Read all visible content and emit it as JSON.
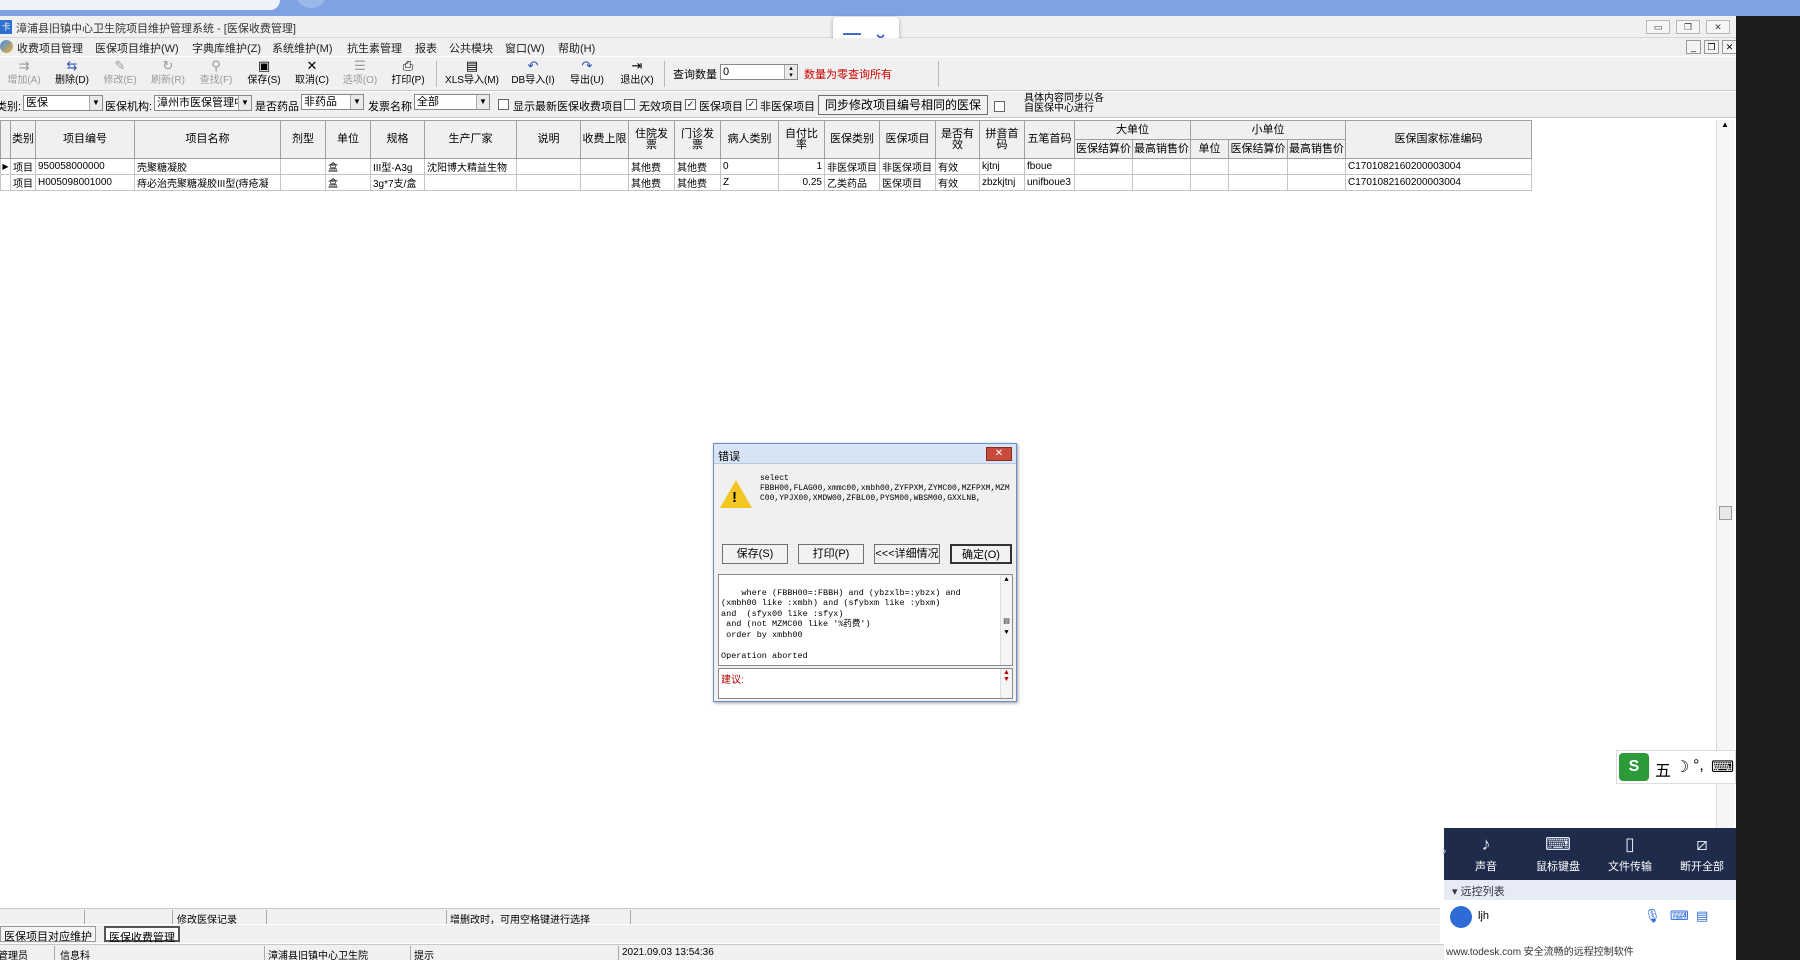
{
  "app": {
    "title": "漳浦县旧镇中心卫生院项目维护管理系统 - [医保收费管理]",
    "icon_char": "卡"
  },
  "menu": [
    "收费项目管理",
    "医保项目维护(W)",
    "字典库维护(Z)",
    "系统维护(M)",
    "抗生素管理",
    "报表",
    "公共模块",
    "窗口(W)",
    "帮助(H)"
  ],
  "toolbar": {
    "buttons": [
      {
        "label": "增加(A)",
        "icon": "add-icon",
        "enabled": false
      },
      {
        "label": "删除(D)",
        "icon": "delete-icon",
        "enabled": true
      },
      {
        "label": "修改(E)",
        "icon": "edit-icon",
        "enabled": false
      },
      {
        "label": "刷新(R)",
        "icon": "refresh-icon",
        "enabled": false
      },
      {
        "label": "查找(F)",
        "icon": "find-icon",
        "enabled": false
      },
      {
        "label": "保存(S)",
        "icon": "save-icon",
        "enabled": true
      },
      {
        "label": "取消(C)",
        "icon": "cancel-icon",
        "enabled": true
      },
      {
        "label": "选项(O)",
        "icon": "options-icon",
        "enabled": false
      },
      {
        "label": "打印(P)",
        "icon": "print-icon",
        "enabled": true
      },
      {
        "label": "XLS导入(M)",
        "icon": "xls-import-icon",
        "enabled": true
      },
      {
        "label": "DB导入(I)",
        "icon": "db-import-icon",
        "enabled": true
      },
      {
        "label": "导出(U)",
        "icon": "export-icon",
        "enabled": true
      },
      {
        "label": "退出(X)",
        "icon": "exit-icon",
        "enabled": true
      }
    ],
    "query_count_label": "查询数量",
    "query_count_value": "0",
    "query_hint": "数量为零查询所有",
    "hint_color": "#cc0000"
  },
  "filters": {
    "category_label": "类别:",
    "category_value": "医保",
    "org_label": "医保机构:",
    "org_value": "漳州市医保管理中",
    "is_drug_label": "是否药品",
    "is_drug_value": "非药品",
    "invoice_label": "发票名称",
    "invoice_value": "全部",
    "show_latest_label": "显示最新医保收费项目",
    "show_latest_checked": false,
    "invalid_label": "无效项目",
    "invalid_checked": false,
    "insured_label": "医保项目",
    "insured_checked": true,
    "non_insured_label": "非医保项目",
    "non_insured_checked": true,
    "sync_button": "同步修改项目编号相同的医保",
    "sync_checked": false,
    "sync_note_line1": "具体内容同步以各",
    "sync_note_line2": "自医保中心进行"
  },
  "grid": {
    "headers": [
      "类别",
      "项目编号",
      "项目名称",
      "剂型",
      "单位",
      "规格",
      "生产厂家",
      "说明",
      "收费上限",
      "住院发票",
      "门诊发票",
      "病人类别",
      "自付比率",
      "医保类别",
      "医保项目",
      "是否有效",
      "拼音首码",
      "五笔首码",
      "大单位",
      "小单位",
      "医保国家标准编码"
    ],
    "big_unit_sub": [
      "医保结算价",
      "最高销售价"
    ],
    "small_unit_sub": [
      "单位",
      "医保结算价",
      "最高销售价"
    ],
    "rows": [
      {
        "cat": "项目",
        "code": "950058000000",
        "name": "壳聚糖凝胶",
        "form": "",
        "unit": "盒",
        "spec": "III型-A3g",
        "maker": "沈阳博大精益生物",
        "note": "",
        "cap": "",
        "inpatient_invoice": "其他费",
        "outpatient_invoice": "其他费",
        "patient_type": "0",
        "self_pay": "1",
        "ins_type": "非医保项目",
        "ins_item": "非医保项目",
        "valid": "有效",
        "py": "kjtnj",
        "wb": "fboue",
        "big_price": "",
        "big_max": "",
        "small_unit": "",
        "small_price": "",
        "small_max": "",
        "national_code": "C1701082160200003004"
      },
      {
        "cat": "项目",
        "code": "H005098001000",
        "name": "痔必治壳聚糖凝胶III型(痔疮凝",
        "form": "",
        "unit": "盒",
        "spec": "3g*7支/盒",
        "maker": "",
        "note": "",
        "cap": "",
        "inpatient_invoice": "其他费",
        "outpatient_invoice": "其他费",
        "patient_type": "Z",
        "self_pay": "0.25",
        "ins_type": "乙类药品",
        "ins_item": "医保项目",
        "valid": "有效",
        "py": "zbzkjtnj",
        "wb": "unifboue3",
        "big_price": "",
        "big_max": "",
        "small_unit": "",
        "small_price": "",
        "small_max": "",
        "national_code": "C1701082160200003004"
      }
    ]
  },
  "dialog": {
    "title": "错误",
    "message": "select\nFBBH00,FLAG00,xmmc00,xmbh00,ZYFPXM,ZYMC00,MZFPXM,MZMC00,YPJX00,XMDW00,ZFBL00,PYSM00,WBSM00,GXXLNB,",
    "buttons": [
      "保存(S)",
      "打印(P)",
      "<<<详细情况",
      "确定(O)"
    ],
    "detail": "where (FBBH00=:FBBH) and (ybzxlb=:ybzx) and\n(xmbh00 like :xmbh) and (sfybxm like :ybxm)\nand  (sfyx00 like :sfyx)\n and (not MZMC00 like '%药费')\n order by xmbh00\n\nOperation aborted",
    "advice_label": "建议:"
  },
  "float_controls": {
    "minimize": "—",
    "expand": "⌄"
  },
  "ime": [
    "五",
    "☽",
    "°,",
    "⌨",
    "👤"
  ],
  "todesk": {
    "actions": [
      "声音",
      "鼠标键盘",
      "文件传输",
      "断开全部"
    ],
    "section": "远控列表",
    "user": "ljh",
    "footer": "www.todesk.com 安全流畅的远程控制软件"
  },
  "status1": {
    "modify_record": "修改医保记录",
    "hint": "增删改时，可用空格键进行选择"
  },
  "window_tabs": [
    "医保项目对应维护",
    "医保收费管理"
  ],
  "status2": {
    "role": "管理员",
    "dept": "信息科",
    "hospital": "漳浦县旧镇中心卫生院",
    "tip": "提示",
    "datetime": "2021.09.03  13:54:36"
  }
}
